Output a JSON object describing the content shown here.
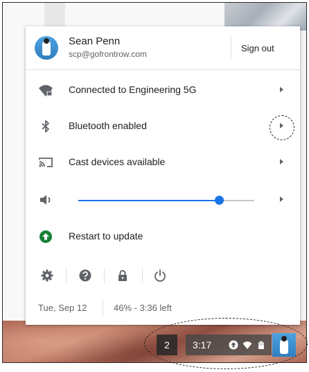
{
  "user": {
    "name": "Sean Penn",
    "email": "scp@gofrontrow.com",
    "sign_out_label": "Sign out"
  },
  "items": [
    {
      "label": "Connected to Engineering 5G",
      "icon": "wifi-locked-icon"
    },
    {
      "label": "Bluetooth enabled",
      "icon": "bluetooth-icon"
    },
    {
      "label": "Cast devices available",
      "icon": "cast-icon"
    },
    {
      "label": "Restart to update",
      "icon": "update-arrow-icon"
    }
  ],
  "volume": {
    "level_percent": 80,
    "icon": "speaker-icon"
  },
  "bottom_icons": [
    "gear-icon",
    "help-icon",
    "lock-icon",
    "power-icon"
  ],
  "status": {
    "date": "Tue, Sep 12",
    "battery": "46% - 3:36 left"
  },
  "shelf": {
    "notification_count": "2",
    "time": "3:17"
  },
  "colors": {
    "accent": "#1a73e8",
    "update_green": "#188038"
  }
}
